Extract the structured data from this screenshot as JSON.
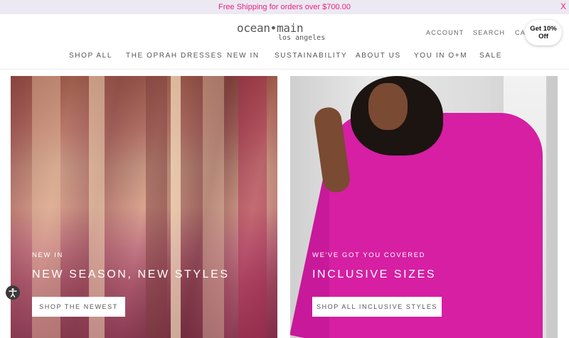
{
  "announcement": {
    "text": "Free Shipping for orders over $700.00",
    "close_label": "X"
  },
  "brand": {
    "line1": "ocean•main",
    "line2": "los angeles"
  },
  "utility_nav": {
    "account": "ACCOUNT",
    "search": "SEARCH",
    "cart": "CART (0)"
  },
  "promo_badge": {
    "line1": "Get 10%",
    "line2": "Off"
  },
  "main_nav": [
    "SHOP ALL",
    "THE OPRAH DRESSES",
    "NEW IN",
    "SUSTAINABILITY",
    "ABOUT US",
    "YOU IN O+M",
    "SALE"
  ],
  "hero_left": {
    "kicker": "NEW IN",
    "title": "NEW SEASON, NEW STYLES",
    "cta": "SHOP THE NEWEST"
  },
  "hero_right": {
    "kicker": "WE'VE GOT YOU COVERED",
    "title": "INCLUSIVE SIZES",
    "cta": "SHOP ALL INCLUSIVE STYLES"
  },
  "accessibility_icon": "accessibility-icon",
  "colors": {
    "announcement_text": "#e6237d",
    "announcement_bg": "#ece9f3",
    "dress_accent": "#d61fa3"
  }
}
